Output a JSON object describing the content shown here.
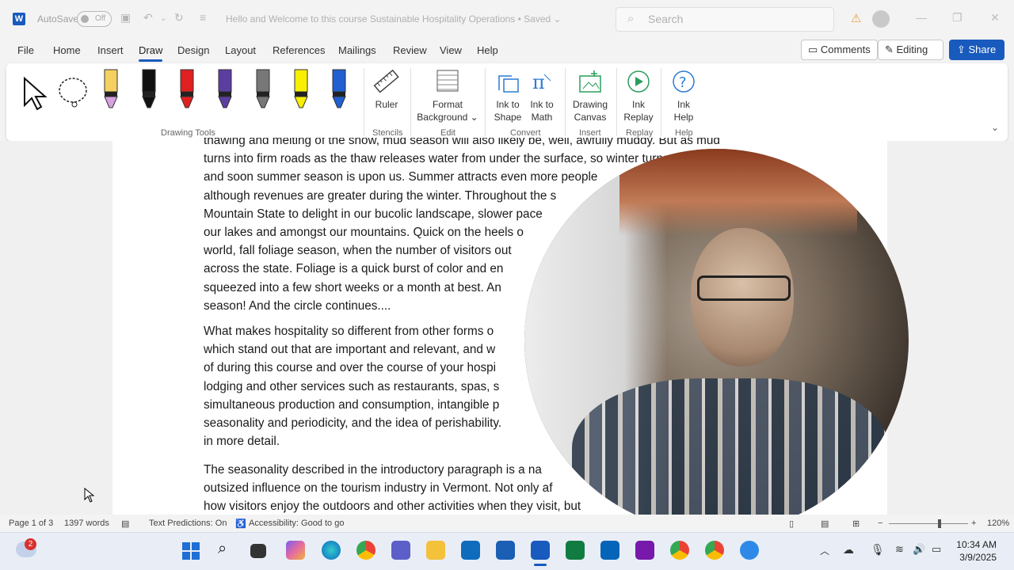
{
  "titlebar": {
    "autosave_label": "AutoSave",
    "autosave_state": "Off",
    "document_title": "Hello and Welcome to this course Sustainable Hospitality Operations • Saved ⌄",
    "search_placeholder": "Search"
  },
  "menu": {
    "tabs": [
      "File",
      "Home",
      "Insert",
      "Draw",
      "Design",
      "Layout",
      "References",
      "Mailings",
      "Review",
      "View",
      "Help"
    ],
    "active_tab": "Draw",
    "comments_label": "Comments",
    "editing_label": "Editing",
    "share_label": "Share"
  },
  "ribbon": {
    "groups": {
      "drawing_tools": "Drawing Tools",
      "stencils": "Stencils",
      "edit": "Edit",
      "convert": "Convert",
      "insert": "Insert",
      "replay": "Replay",
      "help": "Help"
    },
    "tools": {
      "ruler": "Ruler",
      "format_background_1": "Format",
      "format_background_2": "Background ⌄",
      "ink_to_shape_1": "Ink to",
      "ink_to_shape_2": "Shape",
      "ink_to_math_1": "Ink to",
      "ink_to_math_2": "Math",
      "drawing_canvas_1": "Drawing",
      "drawing_canvas_2": "Canvas",
      "ink_replay_1": "Ink",
      "ink_replay_2": "Replay",
      "ink_help_1": "Ink",
      "ink_help_2": "Help"
    },
    "pen_colors": [
      "#f4d060",
      "#111111",
      "#e02020",
      "#5b3fa0",
      "#777777",
      "#f8f000",
      "#2060d0"
    ]
  },
  "document": {
    "para1": "thawing and melting of the snow, mud season will also likely be, well, awfully muddy.  But as mud\nturns into firm roads as the thaw releases water from under the surface, so winter turns to spring,\nand soon summer season is upon us.  Summer attracts even more people\nalthough revenues are greater during the winter.  Throughout the s\nMountain State to delight in our bucolic landscape, slower pace\nour lakes and amongst our mountains.  Quick on the heels o\nworld, fall foliage season, when the number of visitors out\nacross the state.  Foliage is a quick burst of color and en\nsqueezed into a few short weeks or a month at best.  An\nseason!  And the circle continues....",
    "para2": "What makes hospitality so different from other forms o\nwhich stand out that are important and relevant, and w\nof during this course and over the course of your hospi\nlodging and other services such as restaurants, spas, s\nsimultaneous production and consumption, intangible p\nseasonality and periodicity, and the idea of perishability.\nin more detail.",
    "para3": "The seasonality described in the introductory paragraph is a na\noutsized influence on the tourism industry in Vermont.  Not only af\nhow visitors enjoy the outdoors and other activities when they visit, but"
  },
  "status": {
    "page": "Page 1 of 3",
    "words": "1397 words",
    "text_predictions": "Text Predictions: On",
    "accessibility": "Accessibility: Good to go",
    "zoom": "120%"
  },
  "taskbar": {
    "weather_badge": "2",
    "time": "10:34 AM",
    "date": "3/9/2025"
  }
}
